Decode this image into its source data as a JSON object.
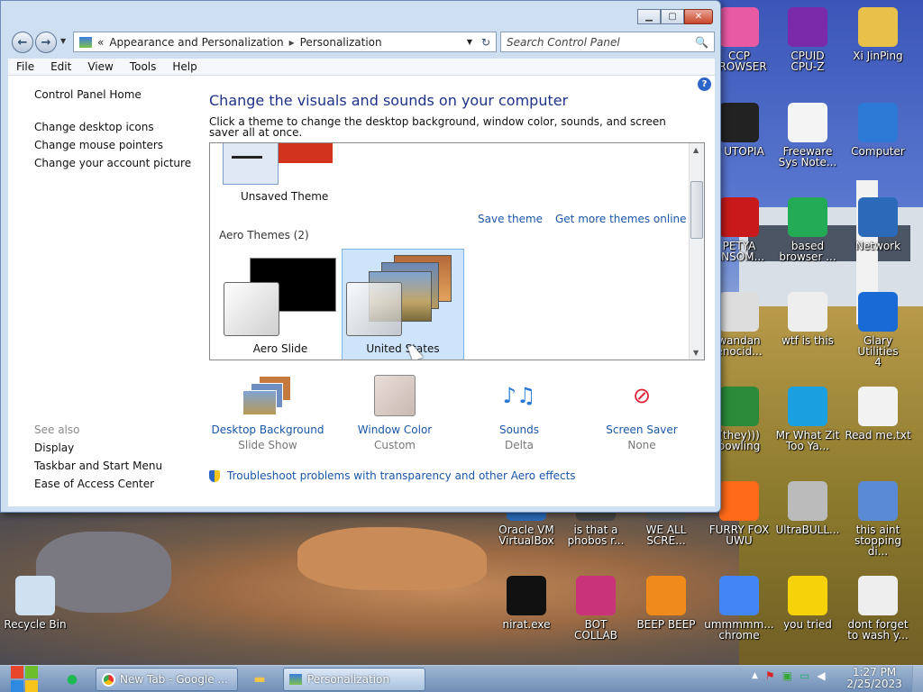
{
  "window": {
    "breadcrumb": [
      "Appearance and Personalization",
      "Personalization"
    ],
    "search_placeholder": "Search Control Panel",
    "menu": [
      "File",
      "Edit",
      "View",
      "Tools",
      "Help"
    ],
    "left_links": [
      "Control Panel Home",
      "Change desktop icons",
      "Change mouse pointers",
      "Change your account picture"
    ],
    "see_also_title": "See also",
    "see_also": [
      "Display",
      "Taskbar and Start Menu",
      "Ease of Access Center"
    ],
    "heading": "Change the visuals and sounds on your computer",
    "subtitle": "Click a theme to change the desktop background, window color, sounds, and screen saver all at once.",
    "unsaved_theme": "Unsaved Theme",
    "save_theme": "Save theme",
    "get_more": "Get more themes online",
    "aero_title": "Aero Themes (2)",
    "themes": [
      "Aero Slide",
      "United States"
    ],
    "tiles": [
      {
        "label": "Desktop Background",
        "sub": "Slide Show"
      },
      {
        "label": "Window Color",
        "sub": "Custom"
      },
      {
        "label": "Sounds",
        "sub": "Delta"
      },
      {
        "label": "Screen Saver",
        "sub": "None"
      }
    ],
    "troubleshoot": "Troubleshoot problems with transparency and other Aero effects"
  },
  "desktop_icons": [
    {
      "label": "CCP\nBROWSER",
      "name": "ccp-browser-icon"
    },
    {
      "label": "CPUID\nCPU-Z",
      "name": "cpuz-icon"
    },
    {
      "label": "Xi JinPing",
      "name": "folder-icon"
    },
    {
      "label": "P UTOPIA",
      "name": "utopia-icon"
    },
    {
      "label": "Freeware\nSys Note...",
      "name": "document-icon"
    },
    {
      "label": "Computer",
      "name": "computer-icon"
    },
    {
      "label": "PETYA\nANSOM...",
      "name": "skull-icon"
    },
    {
      "label": "based\nbrowser ...",
      "name": "browser-icon"
    },
    {
      "label": "Network",
      "name": "network-icon"
    },
    {
      "label": "wandan\nenocid...",
      "name": "meme-icon"
    },
    {
      "label": "wtf is this",
      "name": "file-icon"
    },
    {
      "label": "Glary Utilities\n4",
      "name": "glary-icon"
    },
    {
      "label": "(they)))\nbowling",
      "name": "bowling-icon"
    },
    {
      "label": "Mr What Zit\nToo Ya...",
      "name": "skype-icon"
    },
    {
      "label": "Read me.txt",
      "name": "text-file-icon"
    },
    {
      "label": "Oracle VM\nVirtualBox",
      "name": "virtualbox-icon"
    },
    {
      "label": "is that a\nphobos r...",
      "name": "phobos-icon"
    },
    {
      "label": "WE ALL\nSCRE...",
      "name": "scream-icon"
    },
    {
      "label": "FURRY FOX\nUWU",
      "name": "firefox-icon"
    },
    {
      "label": "UltraBULL...",
      "name": "disc-icon"
    },
    {
      "label": "this aint\nstopping di...",
      "name": "installer-icon"
    },
    {
      "label": "Recycle Bin",
      "name": "recycle-bin-icon"
    },
    {
      "label": "nirat.exe",
      "name": "skull-exe-icon"
    },
    {
      "label": "BOT\nCOLLAB",
      "name": "bot-icon"
    },
    {
      "label": "BEEP BEEP",
      "name": "vlc-icon"
    },
    {
      "label": "ummmmm...\nchrome",
      "name": "chrome-icon"
    },
    {
      "label": "you tried",
      "name": "star-icon"
    },
    {
      "label": "dont forget\nto wash y...",
      "name": "file2-icon"
    }
  ],
  "taskbar": {
    "chrome_tab": "New Tab - Google ...",
    "personalization": "Personalization",
    "time": "1:27 PM",
    "date": "2/25/2023"
  }
}
